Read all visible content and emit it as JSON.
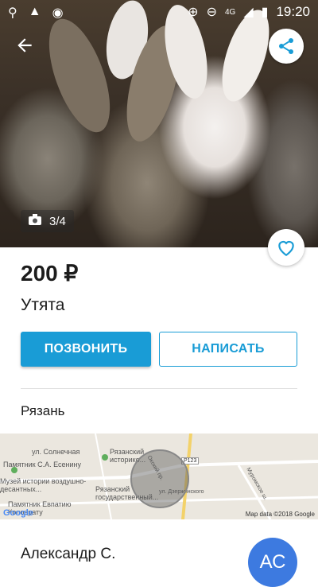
{
  "status_bar": {
    "time": "19:20",
    "network": "4G"
  },
  "listing": {
    "photo_counter": "3/4",
    "price": "200 ₽",
    "title": "Утята",
    "call_label": "ПОЗВОНИТЬ",
    "write_label": "НАПИСАТЬ",
    "city": "Рязань"
  },
  "map": {
    "labels": [
      "ул. Солнечная",
      "Памятник С.А. Есенину",
      "Рязанский историко...",
      "Музей истории воздушно-десантных...",
      "Рязанский государственный...",
      "Памятник Евпатию Коловрату",
      "Окский пр.",
      "ул. Дзержинского",
      "Муромское ш.",
      "Р123"
    ],
    "copyright": "Map data ©2018 Google",
    "logo": "Google"
  },
  "seller": {
    "name": "Александр С.",
    "initials": "АС"
  },
  "colors": {
    "accent": "#199cd6",
    "avatar": "#3d7ae0"
  }
}
